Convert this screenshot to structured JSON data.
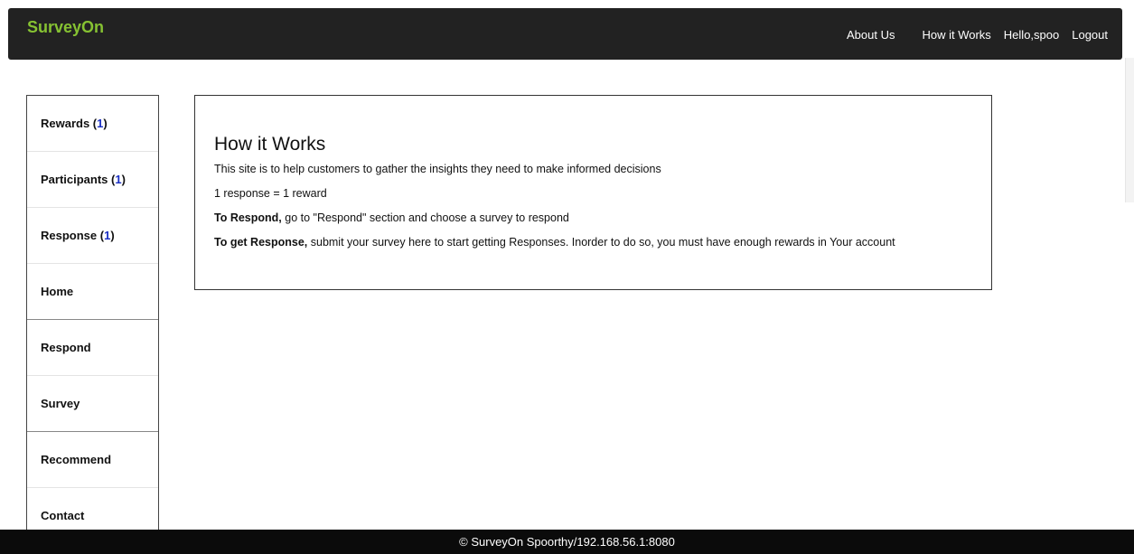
{
  "navbar": {
    "brand": "SurveyOn",
    "links": {
      "about": "About Us",
      "how": "How it Works",
      "hello": "Hello,spoo",
      "logout": "Logout"
    }
  },
  "sidebar": {
    "items": [
      {
        "label": "Rewards (",
        "count": "1",
        "close": ")"
      },
      {
        "label": "Participants (",
        "count": "1",
        "close": ")"
      },
      {
        "label": "Response (",
        "count": "1",
        "close": ")"
      },
      {
        "label": "Home"
      },
      {
        "label": "Respond"
      },
      {
        "label": "Survey"
      },
      {
        "label": "Recommend"
      },
      {
        "label": "Contact"
      }
    ]
  },
  "content": {
    "title": "How it Works",
    "line1": "This site is to help customers to gather the insights they need to make informed decisions",
    "line2": "1 response = 1 reward",
    "respond_bold": "To Respond,",
    "respond_text": " go to \"Respond\" section and choose a survey to respond",
    "get_bold": "To get Response,",
    "get_text": " submit your survey here to start getting Responses. Inorder to do so, you must have enough rewards in Your account"
  },
  "footer": {
    "text": "© SurveyOn Spoorthy/192.168.56.1:8080"
  },
  "colors": {
    "brand": "#86c232",
    "navbar_bg": "#222222",
    "count": "#1a2fc4",
    "footer_bg": "#0b0b0b"
  }
}
